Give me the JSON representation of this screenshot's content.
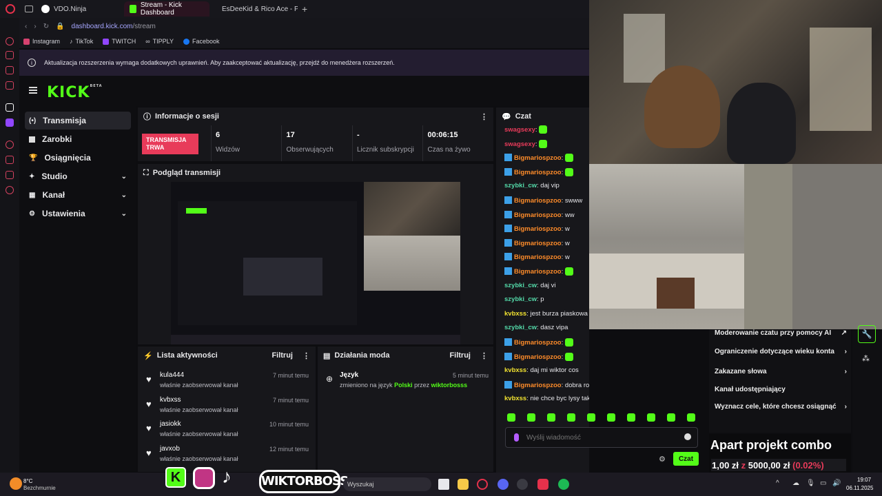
{
  "browser": {
    "tabs": [
      {
        "label": "VDO.Ninja"
      },
      {
        "label": "Stream - Kick Dashboard"
      },
      {
        "label": "EsDeeKid & Rico Ace - Ph"
      }
    ],
    "url_host": "dashboard.kick.com",
    "url_path": "/stream",
    "bookmarks": [
      "Instagram",
      "TikTok",
      "TWITCH",
      "TIPPLY",
      "Facebook"
    ],
    "notice": "Aktualizacja rozszerzenia wymaga dodatkowych uprawnień. Aby zaakceptować aktualizację, przejdź do menedżera rozszerzeń."
  },
  "kick": {
    "logo": "KICK",
    "logo_badge": "BETA",
    "sidebar": [
      {
        "label": "Transmisja",
        "icon": "broadcast-icon"
      },
      {
        "label": "Zarobki",
        "icon": "earnings-icon"
      },
      {
        "label": "Osiągnięcia",
        "icon": "trophy-icon"
      },
      {
        "label": "Studio",
        "icon": "studio-icon"
      },
      {
        "label": "Kanał",
        "icon": "channel-icon"
      },
      {
        "label": "Ustawienia",
        "icon": "gear-icon"
      }
    ],
    "session": {
      "title": "Informacje o sesji",
      "badge": "TRANSMISJA TRWA",
      "stats": [
        {
          "value": "6",
          "label": "Widzów"
        },
        {
          "value": "17",
          "label": "Obserwujących"
        },
        {
          "value": "-",
          "label": "Licznik subskrypcji"
        },
        {
          "value": "00:06:15",
          "label": "Czas na żywo"
        }
      ]
    },
    "preview": {
      "title": "Podgląd transmisji"
    },
    "activity": {
      "title": "Lista aktywności",
      "filter": "Filtruj",
      "rows": [
        {
          "name": "kula444",
          "desc": "właśnie zaobserwował kanał",
          "time": "7 minut temu"
        },
        {
          "name": "kvbxss",
          "desc": "właśnie zaobserwował kanał",
          "time": "7 minut temu"
        },
        {
          "name": "jasiokk",
          "desc": "właśnie zaobserwował kanał",
          "time": "10 minut temu"
        },
        {
          "name": "javxob",
          "desc": "właśnie zaobserwował kanał",
          "time": "12 minut temu"
        }
      ]
    },
    "modact": {
      "title": "Działania moda",
      "filter": "Filtruj",
      "row": {
        "name": "Język",
        "time": "5 minut temu",
        "desc1": "zmieniono na język",
        "lang": "Polski",
        "desc2": "przez",
        "by": "wiktorbosss"
      }
    },
    "chat": {
      "title": "Czat",
      "input_placeholder": "Wyślij wiadomość",
      "send": "Czat",
      "messages": [
        {
          "user": "swagsexy",
          "color": "#e83b5a",
          "text": "",
          "badge": false,
          "emote": true
        },
        {
          "user": "swagsexy",
          "color": "#e83b5a",
          "text": "",
          "badge": false,
          "emote": true
        },
        {
          "user": "Bigmariospzoo",
          "color": "#ff8c2a",
          "text": "",
          "badge": true,
          "emote": true
        },
        {
          "user": "Bigmariospzoo",
          "color": "#ff8c2a",
          "text": "",
          "badge": true,
          "emote": true
        },
        {
          "user": "szybki_cw",
          "color": "#53d8a8",
          "text": "daj vip",
          "badge": false
        },
        {
          "user": "Bigmariospzoo",
          "color": "#ff8c2a",
          "text": "swww",
          "badge": true
        },
        {
          "user": "Bigmariospzoo",
          "color": "#ff8c2a",
          "text": "ww",
          "badge": true
        },
        {
          "user": "Bigmariospzoo",
          "color": "#ff8c2a",
          "text": "w",
          "badge": true
        },
        {
          "user": "Bigmariospzoo",
          "color": "#ff8c2a",
          "text": "w",
          "badge": true
        },
        {
          "user": "Bigmariospzoo",
          "color": "#ff8c2a",
          "text": "w",
          "badge": true
        },
        {
          "user": "Bigmariospzoo",
          "color": "#ff8c2a",
          "text": "",
          "badge": true,
          "emote": true
        },
        {
          "user": "szybki_cw",
          "color": "#53d8a8",
          "text": "daj vi",
          "badge": false
        },
        {
          "user": "szybki_cw",
          "color": "#53d8a8",
          "text": "p",
          "badge": false
        },
        {
          "user": "kvbxss",
          "color": "#f0e130",
          "text": "jest burza piaskowa n",
          "badge": false
        },
        {
          "user": "szybki_cw",
          "color": "#53d8a8",
          "text": "dasz vipa",
          "badge": false
        },
        {
          "user": "Bigmariospzoo",
          "color": "#ff8c2a",
          "text": "",
          "badge": true,
          "emote": true
        },
        {
          "user": "Bigmariospzoo",
          "color": "#ff8c2a",
          "text": "",
          "badge": true,
          "emote": true
        },
        {
          "user": "kvbxss",
          "color": "#f0e130",
          "text": "daj mi wiktor cos",
          "badge": false
        },
        {
          "user": "Bigmariospzoo",
          "color": "#ff8c2a",
          "text": "dobra robicie to",
          "badge": true
        },
        {
          "user": "kvbxss",
          "color": "#f0e130",
          "text": "nie chce byc lysy taki",
          "badge": false
        }
      ]
    }
  },
  "overlay": {
    "menu": [
      {
        "label": "Moderowanie czatu przy pomocy AI",
        "chev": "↗"
      },
      {
        "label": "Ograniczenie dotyczące wieku konta",
        "chev": "›"
      },
      {
        "label": "Zakazane słowa",
        "chev": "›"
      },
      {
        "label": "Kanał udostępniający",
        "chev": ""
      },
      {
        "label": "Wyznacz cele, które chcesz osiągnąć",
        "chev": "›"
      }
    ],
    "goal_title": "Apart projekt combo",
    "goal_current": "1,00 zł",
    "goal_sep": "z",
    "goal_target": "5000,00 zł",
    "goal_pct": "(0.02%)",
    "progress": 0.0002
  },
  "taskbar": {
    "weather_temp": "8°C",
    "weather_desc": "Bezchmurnie",
    "brand_text": "WIKTORBOSS",
    "search": "Wyszukaj",
    "time": "19:07",
    "date": "06.11.2025"
  },
  "colors": {
    "kick_green": "#53fc18",
    "live_red": "#e83b5a"
  }
}
